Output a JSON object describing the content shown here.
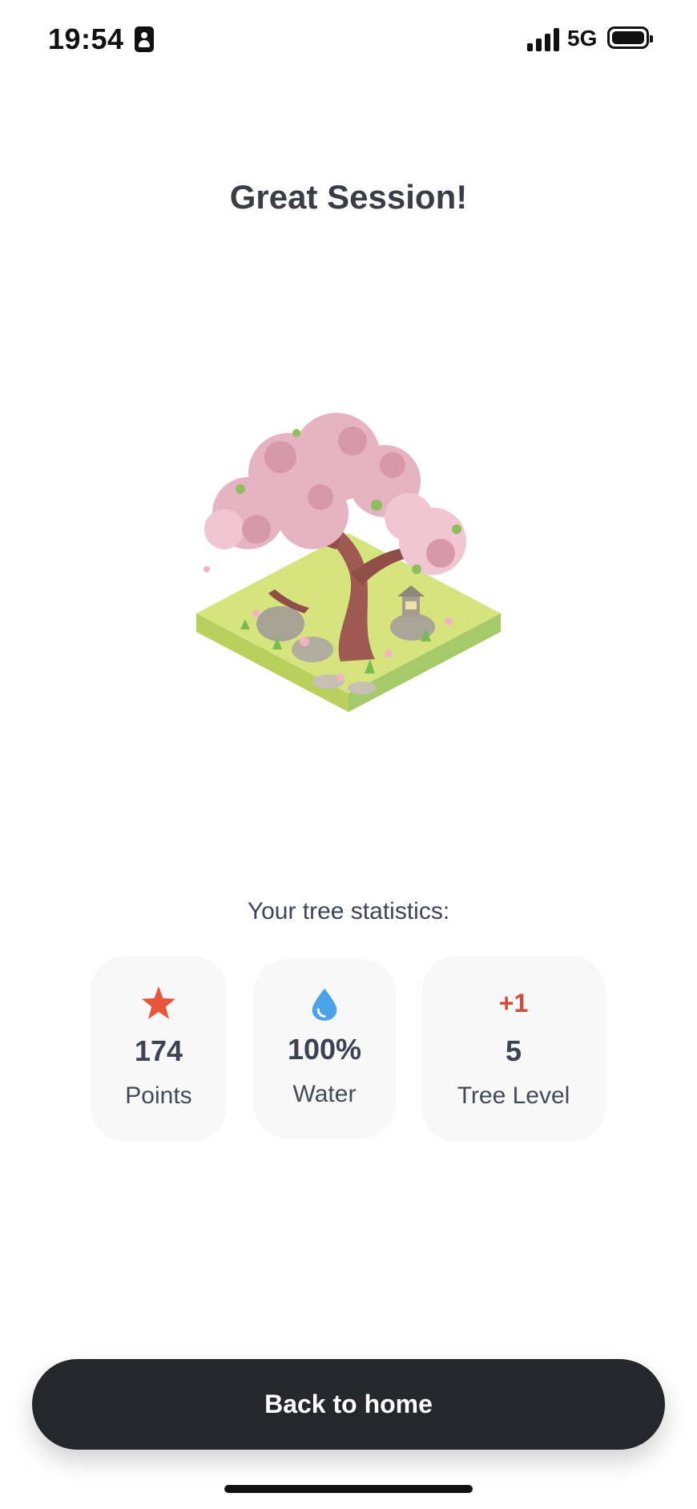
{
  "status_bar": {
    "time": "19:54",
    "network": "5G"
  },
  "title": "Great Session!",
  "stats": {
    "heading": "Your tree statistics:",
    "points": {
      "value": "174",
      "label": "Points",
      "icon": "star-icon"
    },
    "water": {
      "value": "100%",
      "label": "Water",
      "icon": "water-drop-icon"
    },
    "level": {
      "badge": "+1",
      "value": "5",
      "label": "Tree Level"
    }
  },
  "back_button": {
    "label": "Back to home"
  },
  "colors": {
    "star": "#e8553a",
    "drop": "#4aa3e8",
    "badge": "#d64a3e",
    "button": "#25272d"
  }
}
